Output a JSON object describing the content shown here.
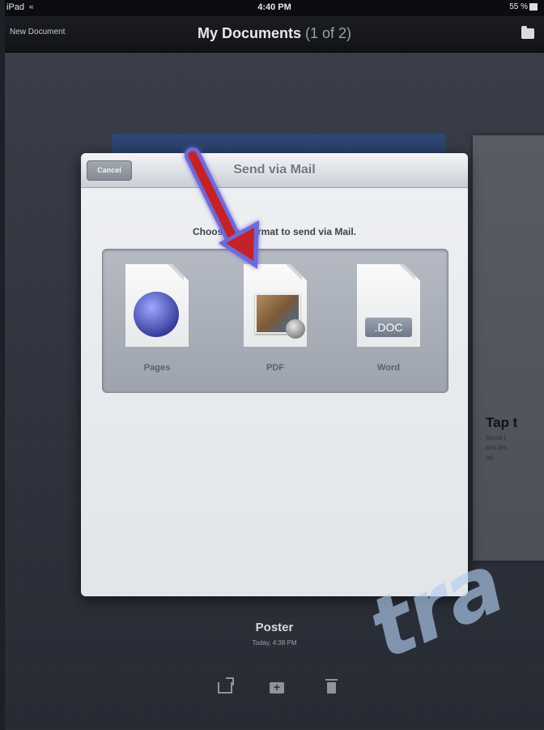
{
  "status_bar": {
    "carrier": "iPad",
    "time": "4:40 PM",
    "battery": "55 %"
  },
  "nav_bar": {
    "left_button": "New Document",
    "title": "My Documents",
    "page_count": "(1 of 2)",
    "right_icon": "folder-icon"
  },
  "background_doc": {
    "heading": "Tap t",
    "body": "Scroll t\nand tex\npp"
  },
  "modal": {
    "cancel_label": "Cancel",
    "title": "Send via Mail",
    "prompt": "Choose the format to send via Mail.",
    "formats": [
      {
        "label": "Pages",
        "icon": "pages-icon"
      },
      {
        "label": "PDF",
        "icon": "pdf-icon"
      },
      {
        "label": "Word",
        "icon": "doc-file-icon",
        "badge": ".DOC"
      }
    ]
  },
  "annotation": {
    "icon": "red-arrow-icon",
    "color": "#c4202c"
  },
  "document_caption": {
    "title": "Poster",
    "subtitle": "Today, 4:38 PM"
  },
  "toolbar": {
    "items": [
      "share-icon",
      "add-folder-icon",
      "trash-icon"
    ]
  },
  "watermark": {
    "text": "tra"
  }
}
